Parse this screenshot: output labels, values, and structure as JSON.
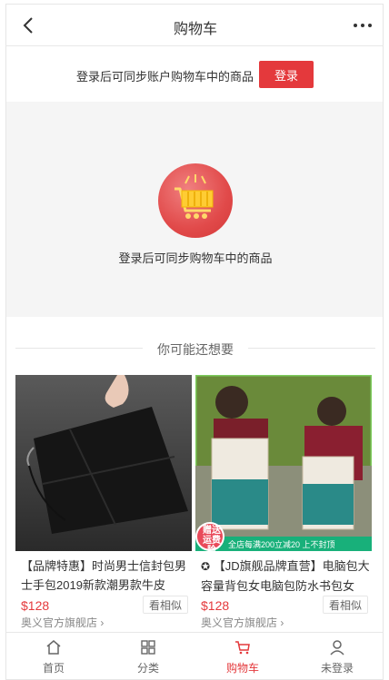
{
  "header": {
    "title": "购物车",
    "back_icon": "chevron-left-icon",
    "more_icon": "more-dots-icon"
  },
  "login_bar": {
    "text": "登录后可同步账户购物车中的商品",
    "button_label": "登录",
    "button_color": "#e4393c"
  },
  "empty_cart": {
    "icon": "shopping-cart-icon",
    "text": "登录后可同步购物车中的商品"
  },
  "recommend": {
    "title": "你可能还想要",
    "products": [
      {
        "name": "【品牌特惠】时尚男士信封包男士手包2019新款潮男款牛皮",
        "price": "$128",
        "similar_label": "看相似",
        "shop": "奥义官方旗舰店"
      },
      {
        "name": "【JD旗舰品牌直营】电脑包大容量背包女电脑包防水书包女",
        "price": "$128",
        "similar_label": "看相似",
        "shop": "奥义官方旗舰店",
        "badge_text": "赠送运费险",
        "banner_text": "全店每满200立减20 上不封顶"
      }
    ]
  },
  "tabbar": {
    "items": [
      {
        "label": "首页",
        "icon": "home-icon"
      },
      {
        "label": "分类",
        "icon": "category-icon"
      },
      {
        "label": "购物车",
        "icon": "cart-icon",
        "active": true
      },
      {
        "label": "未登录",
        "icon": "user-icon"
      }
    ],
    "active_color": "#e4393c"
  }
}
